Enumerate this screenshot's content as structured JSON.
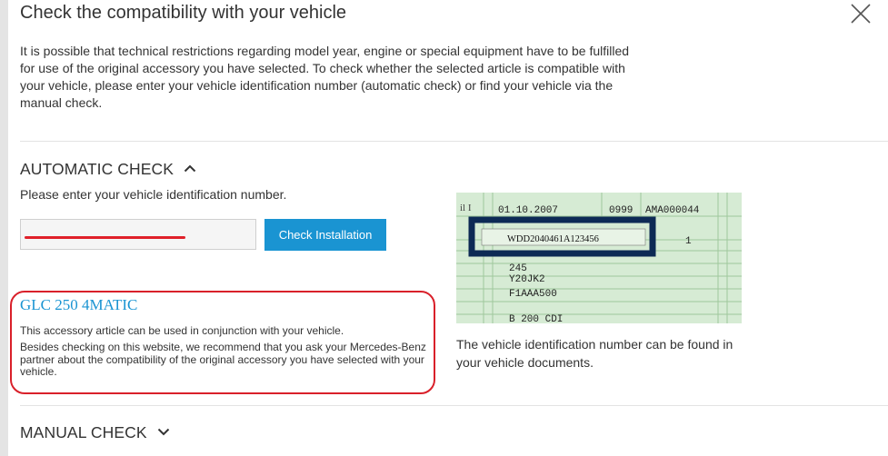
{
  "dialog": {
    "title": "Check the compatibility with your vehicle",
    "intro": "It is possible that technical restrictions regarding model year, engine or special equipment have to be fulfilled for use of the original accessory you have selected. To check whether the selected article is compatible with your vehicle, please enter your vehicle identification number (automatic check) or find your vehicle via the manual check."
  },
  "automatic": {
    "heading": "AUTOMATIC CHECK",
    "prompt": "Please enter your vehicle identification number.",
    "vin_value": "",
    "button_label": "Check Installation"
  },
  "result": {
    "model": "GLC 250 4MATIC",
    "line1": "This accessory article can be used in conjunction with your vehicle.",
    "line2": "Besides checking on this website, we recommend that you ask your Mercedes-Benz partner about the compatibility of the original accessory you have selected with your vehicle."
  },
  "document": {
    "date": "01.10.2007",
    "code1": "0999",
    "code2": "AMA000044",
    "vin": "WDD2040461A123456",
    "seats": "1",
    "field_a": "245",
    "field_b": "Y20JK2",
    "field_c": "F1AAA500",
    "model_name": "B 200 CDI",
    "caption": "The vehicle identification number can be found in your vehicle documents."
  },
  "manual": {
    "heading": "MANUAL CHECK"
  },
  "icons": {
    "close": "close-icon",
    "chevron_up": "chevron-up-icon",
    "chevron_down": "chevron-down-icon"
  },
  "colors": {
    "accent": "#1a94d2",
    "annotation_red": "#e0202a",
    "doc_green": "#cfe6cf",
    "highlight_box": "#0d2a55"
  }
}
